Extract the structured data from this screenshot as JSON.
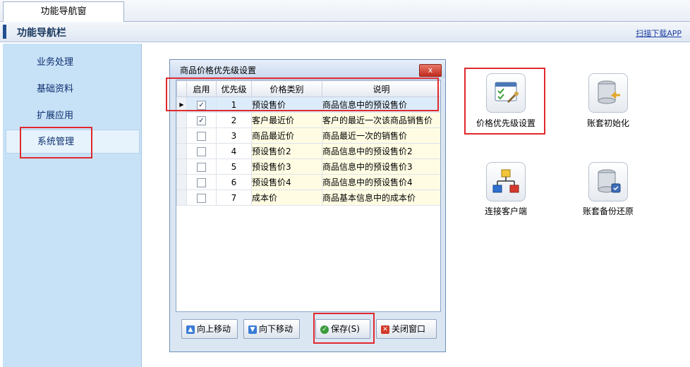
{
  "tabs": [
    {
      "label": "功能导航窗"
    }
  ],
  "header": {
    "title": "功能导航栏",
    "download_link": "扫描下载APP"
  },
  "sidebar": {
    "items": [
      {
        "label": "业务处理"
      },
      {
        "label": "基础资料"
      },
      {
        "label": "扩展应用"
      },
      {
        "label": "系统管理",
        "active": true
      }
    ]
  },
  "dialog": {
    "title": "商品价格优先级设置",
    "close_label": "x",
    "columns": [
      "启用",
      "优先级",
      "价格类别",
      "说明"
    ],
    "rows": [
      {
        "enabled": true,
        "priority": "1",
        "category": "预设售价",
        "desc": "商品信息中的预设售价"
      },
      {
        "enabled": true,
        "priority": "2",
        "category": "客户最近价",
        "desc": "客户的最近一次该商品销售价"
      },
      {
        "enabled": false,
        "priority": "3",
        "category": "商品最近价",
        "desc": "商品最近一次的销售价"
      },
      {
        "enabled": false,
        "priority": "4",
        "category": "预设售价2",
        "desc": "商品信息中的预设售价2"
      },
      {
        "enabled": false,
        "priority": "5",
        "category": "预设售价3",
        "desc": "商品信息中的预设售价3"
      },
      {
        "enabled": false,
        "priority": "6",
        "category": "预设售价4",
        "desc": "商品信息中的预设售价4"
      },
      {
        "enabled": false,
        "priority": "7",
        "category": "成本价",
        "desc": "商品基本信息中的成本价"
      }
    ],
    "buttons": {
      "move_up": "向上移动",
      "move_down": "向下移动",
      "save": "保存(S)",
      "close": "关闭窗口"
    }
  },
  "tools": [
    {
      "label": "价格优先级设置",
      "icon": "price-priority-icon"
    },
    {
      "label": "账套初始化",
      "icon": "database-init-icon"
    },
    {
      "label": "连接客户端",
      "icon": "network-connect-icon"
    },
    {
      "label": "账套备份还原",
      "icon": "database-backup-icon"
    }
  ],
  "colors": {
    "highlight": "#e0292d",
    "sidebar": "#c7e1f7",
    "header_text": "#17375e"
  }
}
